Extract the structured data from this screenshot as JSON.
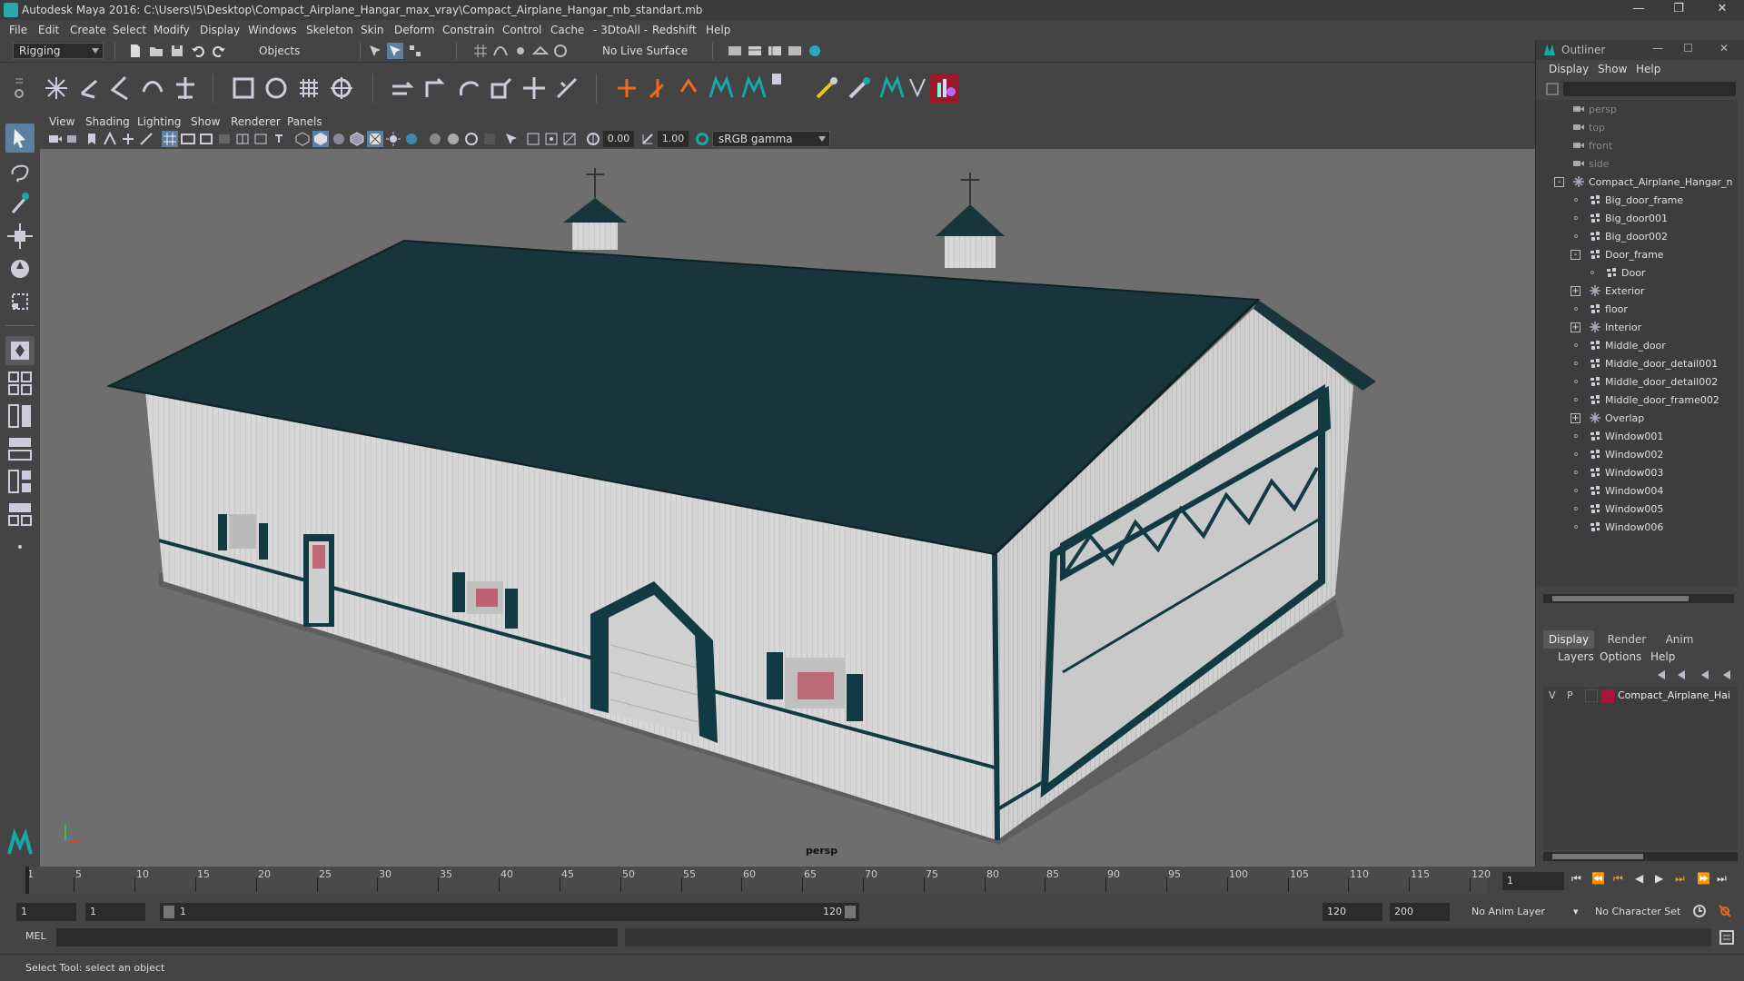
{
  "window": {
    "title": "Autodesk Maya 2016: C:\\Users\\I5\\Desktop\\Compact_Airplane_Hangar_max_vray\\Compact_Airplane_Hangar_mb_standart.mb"
  },
  "menus": [
    "File",
    "Edit",
    "Create",
    "Select",
    "Modify",
    "Display",
    "Windows",
    "Skeleton",
    "Skin",
    "Deform",
    "Constrain",
    "Control",
    "Cache",
    "- 3DtoAll -",
    "Redshift",
    "Help"
  ],
  "status": {
    "mode": "Rigging",
    "select_mode": "Objects",
    "live_surface": "No Live Surface"
  },
  "viewport": {
    "menus": [
      "View",
      "Shading",
      "Lighting",
      "Show",
      "Renderer",
      "Panels"
    ],
    "exposure": "0.00",
    "gamma": "1.00",
    "color_space": "sRGB gamma",
    "camera_label": "persp"
  },
  "outliner": {
    "title": "Outliner",
    "menus": [
      "Display",
      "Show",
      "Help"
    ],
    "items": [
      {
        "label": "persp",
        "kind": "camera",
        "indent": 0,
        "dim": true
      },
      {
        "label": "top",
        "kind": "camera",
        "indent": 0,
        "dim": true
      },
      {
        "label": "front",
        "kind": "camera",
        "indent": 0,
        "dim": true
      },
      {
        "label": "side",
        "kind": "camera",
        "indent": 0,
        "dim": true
      },
      {
        "label": "Compact_Airplane_Hangar_n",
        "kind": "group",
        "indent": 0,
        "expand": "-"
      },
      {
        "label": "Big_door_frame",
        "kind": "mesh",
        "indent": 1
      },
      {
        "label": "Big_door001",
        "kind": "mesh",
        "indent": 1
      },
      {
        "label": "Big_door002",
        "kind": "mesh",
        "indent": 1
      },
      {
        "label": "Door_frame",
        "kind": "mesh",
        "indent": 1,
        "expand": "-"
      },
      {
        "label": "Door",
        "kind": "mesh",
        "indent": 2
      },
      {
        "label": "Exterior",
        "kind": "group",
        "indent": 1,
        "expand": "+"
      },
      {
        "label": "floor",
        "kind": "mesh",
        "indent": 1
      },
      {
        "label": "Interior",
        "kind": "group",
        "indent": 1,
        "expand": "+"
      },
      {
        "label": "Middle_door",
        "kind": "mesh",
        "indent": 1
      },
      {
        "label": "Middle_door_detail001",
        "kind": "mesh",
        "indent": 1
      },
      {
        "label": "Middle_door_detail002",
        "kind": "mesh",
        "indent": 1
      },
      {
        "label": "Middle_door_frame002",
        "kind": "mesh",
        "indent": 1
      },
      {
        "label": "Overlap",
        "kind": "group",
        "indent": 1,
        "expand": "+"
      },
      {
        "label": "Window001",
        "kind": "mesh",
        "indent": 1
      },
      {
        "label": "Window002",
        "kind": "mesh",
        "indent": 1
      },
      {
        "label": "Window003",
        "kind": "mesh",
        "indent": 1
      },
      {
        "label": "Window004",
        "kind": "mesh",
        "indent": 1
      },
      {
        "label": "Window005",
        "kind": "mesh",
        "indent": 1
      },
      {
        "label": "Window006",
        "kind": "mesh",
        "indent": 1
      }
    ]
  },
  "layers": {
    "tabs": [
      "Display",
      "Render",
      "Anim"
    ],
    "menus": [
      "Layers",
      "Options",
      "Help"
    ],
    "rows": [
      {
        "v": "V",
        "p": "P",
        "name": "Compact_Airplane_Hai",
        "color": "#b0103a"
      }
    ]
  },
  "timeline": {
    "ticks": [
      "1",
      "5",
      "10",
      "15",
      "20",
      "25",
      "30",
      "35",
      "40",
      "45",
      "50",
      "55",
      "60",
      "65",
      "70",
      "75",
      "80",
      "85",
      "90",
      "95",
      "100",
      "105",
      "110",
      "115",
      "120"
    ],
    "current_frame": "1",
    "range_start": "1",
    "playback_start": "1",
    "range_slider_start": "1",
    "range_slider_end": "120",
    "playback_end": "120",
    "range_end": "200",
    "anim_layer": "No Anim Layer",
    "char_set": "No Character Set"
  },
  "command": {
    "language": "MEL"
  },
  "help": {
    "text": "Select Tool: select an object"
  }
}
